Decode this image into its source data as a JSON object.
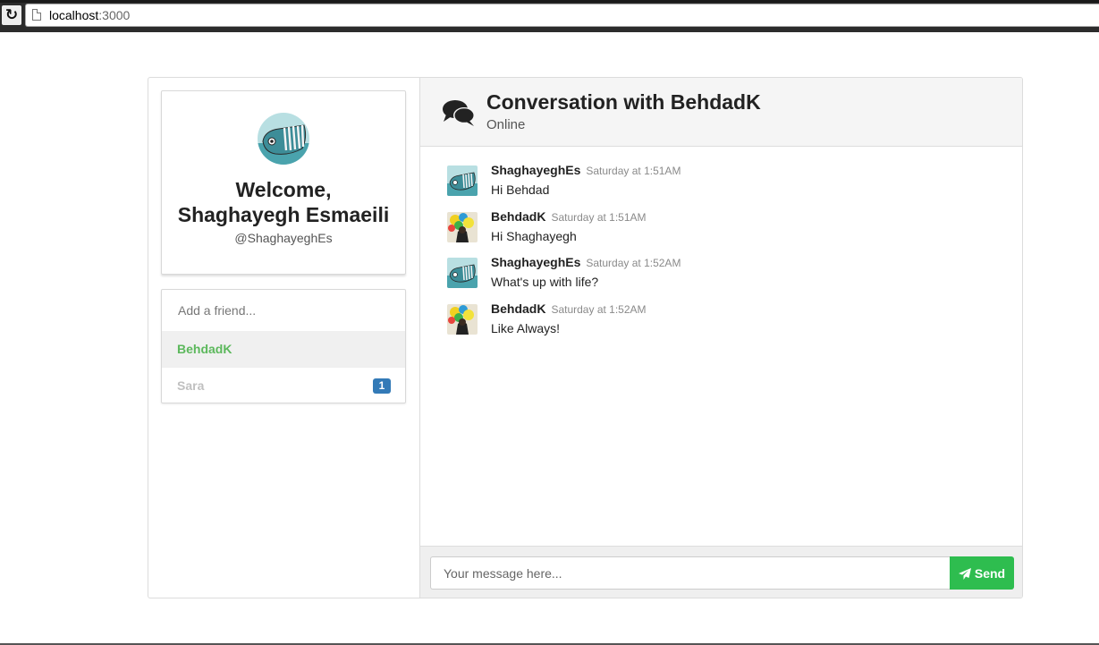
{
  "browser": {
    "url_host": "localhost",
    "url_port": ":3000"
  },
  "profile": {
    "welcome_line1": "Welcome,",
    "welcome_line2": "Shaghayegh Esmaeili",
    "handle": "@ShaghayeghEs"
  },
  "friends": {
    "add_placeholder": "Add a friend...",
    "items": [
      {
        "name": "BehdadK",
        "active": true
      },
      {
        "name": "Sara",
        "active": false,
        "unread": "1"
      }
    ]
  },
  "conversation": {
    "title": "Conversation with BehdadK",
    "status": "Online",
    "icon": "comments-icon"
  },
  "messages": [
    {
      "author": "ShaghayeghEs",
      "time": "Saturday at 1:51AM",
      "text": "Hi Behdad",
      "avatar": "whale-avatar"
    },
    {
      "author": "BehdadK",
      "time": "Saturday at 1:51AM",
      "text": "Hi Shaghayegh",
      "avatar": "balloons-avatar"
    },
    {
      "author": "ShaghayeghEs",
      "time": "Saturday at 1:52AM",
      "text": "What's up with life?",
      "avatar": "whale-avatar"
    },
    {
      "author": "BehdadK",
      "time": "Saturday at 1:52AM",
      "text": "Like Always!",
      "avatar": "balloons-avatar"
    }
  ],
  "composer": {
    "placeholder": "Your message here...",
    "send_label": "Send"
  },
  "colors": {
    "accent_green": "#2ebd4f",
    "active_friend": "#5cb85c",
    "badge_blue": "#337ab7"
  }
}
